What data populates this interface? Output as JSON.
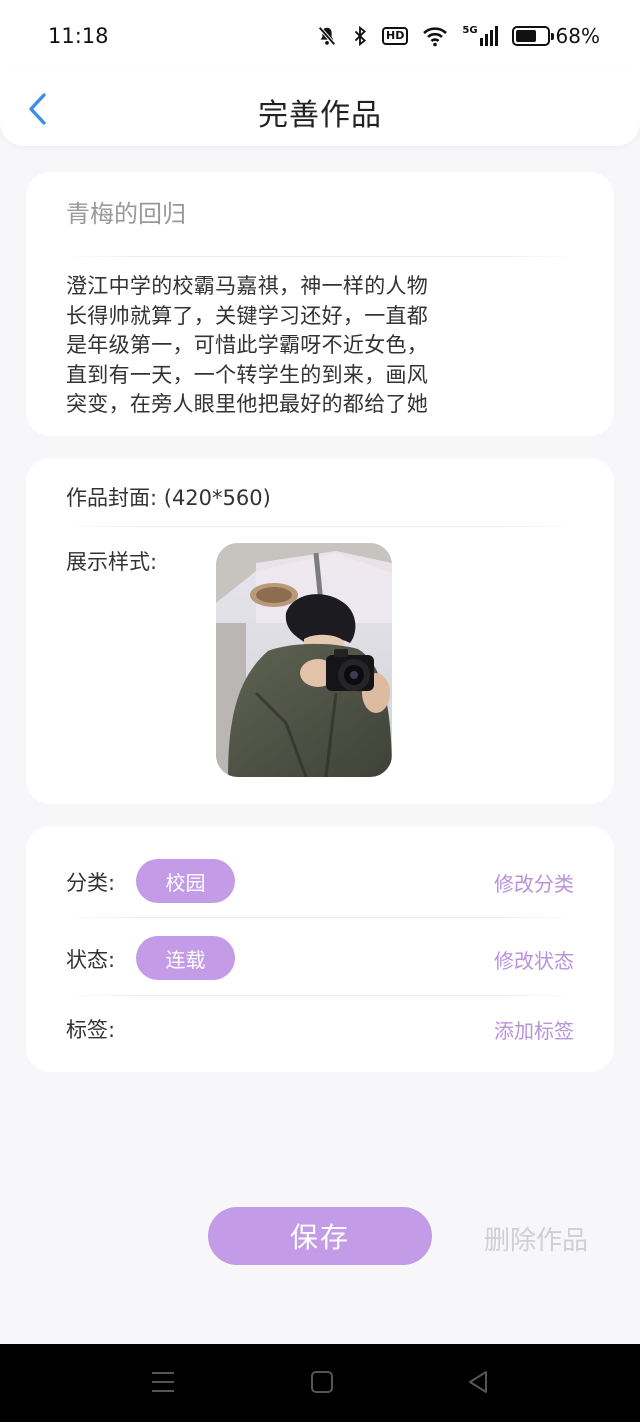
{
  "status_bar": {
    "time": "11:18",
    "network": "5G",
    "battery_level": 0.68,
    "battery_text": "68%",
    "hd_label": "HD",
    "icons": [
      "mute-bell-icon",
      "bluetooth-icon",
      "hd-icon",
      "wifi-icon",
      "signal-icon",
      "battery-icon"
    ]
  },
  "nav": {
    "back_icon": "chevron-left-icon",
    "title": "完善作品"
  },
  "intro": {
    "title": "青梅的回归",
    "body_lines": [
      "澄江中学的校霸马嘉祺，神一样的人物",
      "长得帅就算了，关键学习还好，一直都",
      "是年级第一，可惜此学霸呀不近女色，",
      "直到有一天，一个转学生的到来，画风",
      "突变，在旁人眼里他把最好的都给了她"
    ]
  },
  "cover": {
    "label": "作品封面: (420*560)",
    "style_label": "展示样式:"
  },
  "meta": {
    "category_label": "分类:",
    "category_value": "校园",
    "category_action": "修改分类",
    "status_label": "状态:",
    "status_value": "连载",
    "status_action": "修改状态",
    "tags_label": "标签:",
    "tags_action": "添加标签"
  },
  "actions": {
    "save": "保存",
    "delete": "删除作品"
  },
  "colors": {
    "accent": "#c39be6",
    "accent_text": "#b991dd",
    "back_arrow": "#3b8fe6",
    "background": "#f7f7f9"
  },
  "system_nav": [
    "menu-icon",
    "home-square-icon",
    "back-triangle-icon"
  ]
}
